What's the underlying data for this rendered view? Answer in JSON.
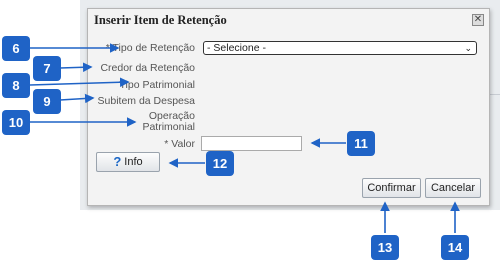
{
  "dialog": {
    "title": "Inserir Item de Retenção",
    "close_icon": "close-x-icon"
  },
  "form": {
    "tipo_retencao_label": "* Tipo de Retenção",
    "tipo_retencao_value": "- Selecione -",
    "credor_label": "Credor da Retenção",
    "tipo_patrimonial_label": "Tipo Patrimonial",
    "subitem_label": "Subitem da Despesa",
    "operacao_label_line1": "Operação",
    "operacao_label_line2": "Patrimonial",
    "valor_label": "* Valor",
    "valor_value": ""
  },
  "buttons": {
    "info_label": "Info",
    "info_icon": "question-mark-icon",
    "confirm_label": "Confirmar",
    "cancel_label": "Cancelar"
  },
  "callouts": [
    "6",
    "7",
    "8",
    "9",
    "10",
    "11",
    "12",
    "13",
    "14"
  ],
  "colors": {
    "callout_blue": "#1f63c6",
    "dialog_bg": "#f3f3f3"
  }
}
